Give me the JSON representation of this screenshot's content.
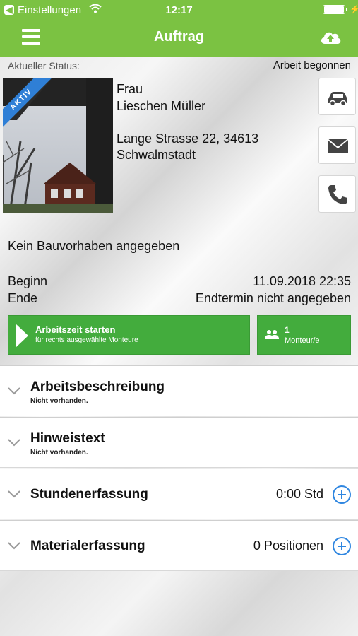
{
  "status_bar": {
    "back_app": "Einstellungen",
    "time": "12:17"
  },
  "nav": {
    "title": "Auftrag",
    "menu_icon": "hamburger-icon",
    "cloud_icon": "cloud-upload-icon"
  },
  "order": {
    "status_label": "Aktueller Status:",
    "status_value": "Arbeit begonnen",
    "photo_badge": "AKTIV",
    "salutation": "Frau",
    "name": "Lieschen Müller",
    "street": "Lange Strasse 22, 34613",
    "city": "Schwalmstadt",
    "project": "Kein Bauvorhaben angegeben",
    "begin_label": "Beginn",
    "begin_value": "11.09.2018 22:35",
    "end_label": "Ende",
    "end_value": "Endtermin nicht angegeben"
  },
  "side_buttons": [
    "car-icon",
    "mail-icon",
    "phone-icon"
  ],
  "actions": {
    "start_title": "Arbeitszeit starten",
    "start_sub": "für rechts ausgewählte Monteure",
    "monteur_count": "1",
    "monteur_label": "Monteur/e"
  },
  "sections": [
    {
      "title": "Arbeitsbeschreibung",
      "subtitle": "Nicht vorhanden."
    },
    {
      "title": "Hinweistext",
      "subtitle": "Nicht vorhanden."
    },
    {
      "title": "Stundenerfassung",
      "value": "0:00 Std"
    },
    {
      "title": "Materialerfassung",
      "value": "0 Positionen"
    }
  ],
  "colors": {
    "brand_green": "#7bc242",
    "button_green": "#43ac3d",
    "badge_blue": "#2f7fd6",
    "plus_blue": "#2f86e0"
  }
}
